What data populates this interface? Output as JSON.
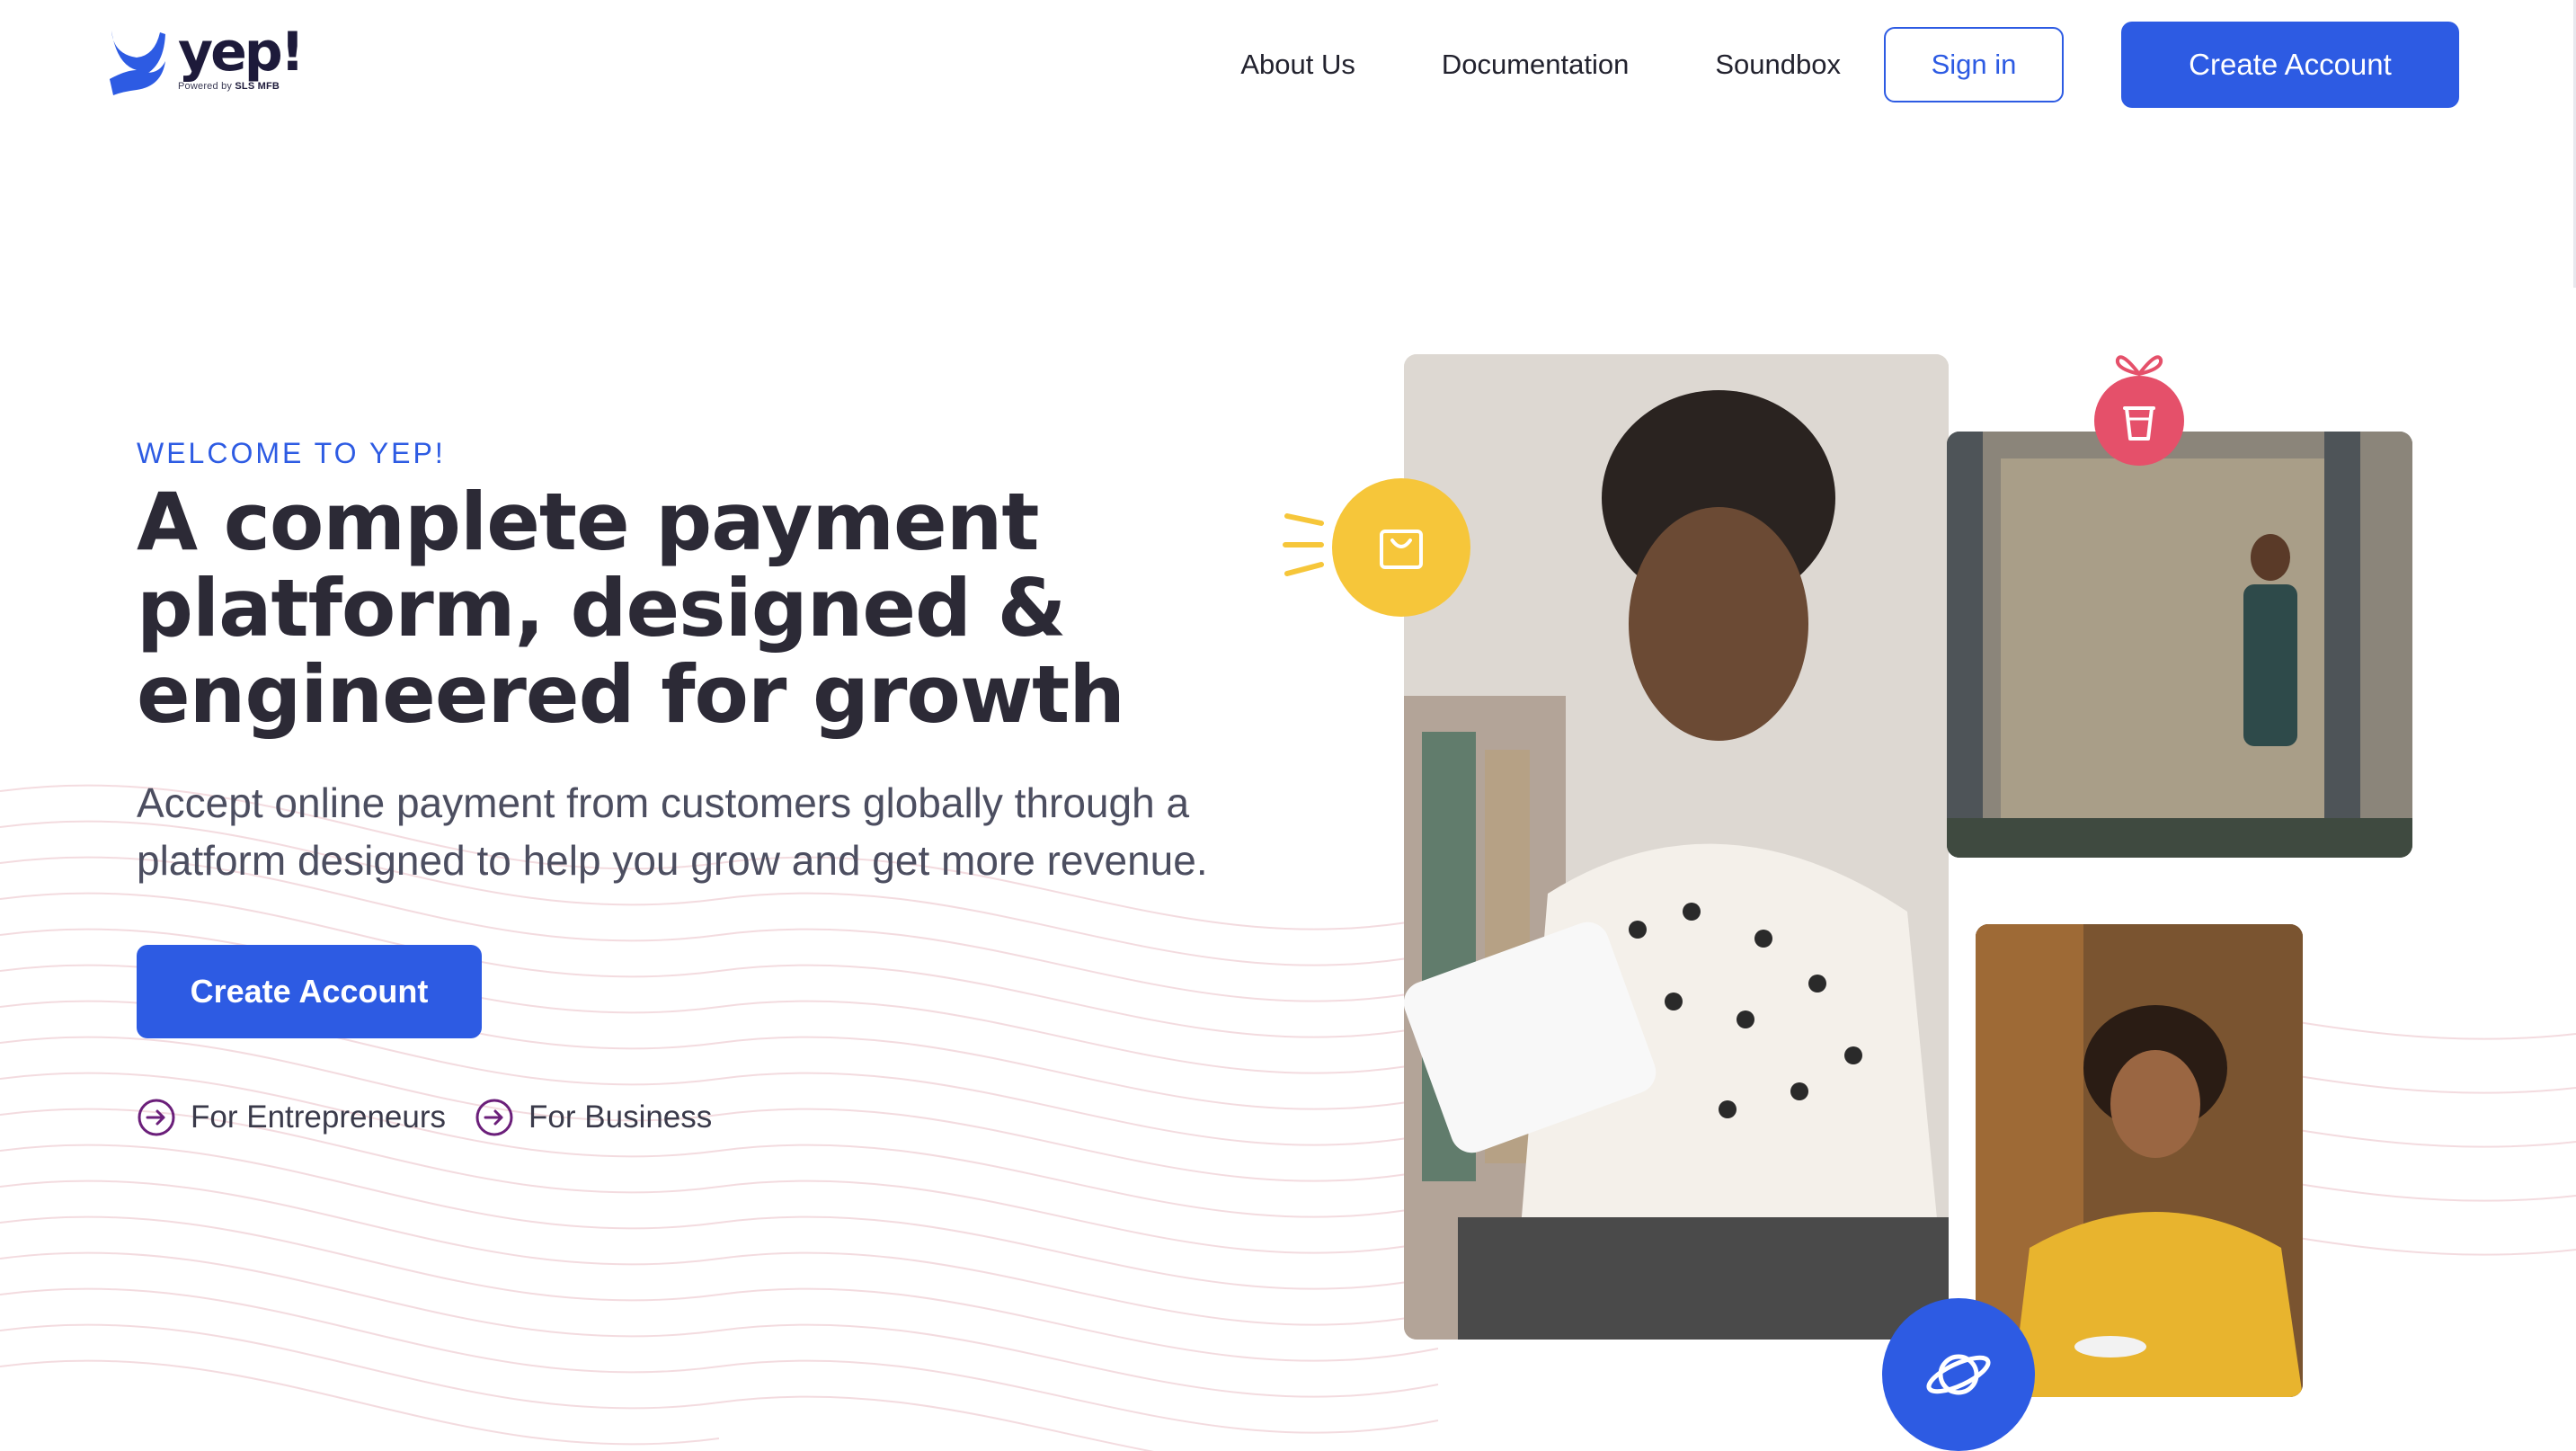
{
  "brand": {
    "name": "yep!",
    "tagline_prefix": "Powered by",
    "tagline_org": "SLS MFB",
    "primary_color": "#2d5be3",
    "accent_yellow": "#f6c63a",
    "accent_pink": "#e5506a"
  },
  "nav": {
    "links": [
      "About Us",
      "Documentation",
      "Soundbox"
    ],
    "sign_in": "Sign in",
    "create_account": "Create Account"
  },
  "hero": {
    "eyebrow": "WELCOME TO YEP!",
    "headline": "A complete payment platform, designed & engineered for growth",
    "subtext": "Accept online payment from customers globally through a platform designed to help you grow and get more revenue.",
    "cta": "Create Account",
    "links": [
      "For Entrepreneurs",
      "For Business"
    ]
  },
  "icons": {
    "logo": "yep-logo-icon",
    "link_arrow": "arrow-circle-right-icon",
    "bag": "shopping-bag-icon",
    "cup": "cup-icon",
    "planet": "planet-icon"
  }
}
